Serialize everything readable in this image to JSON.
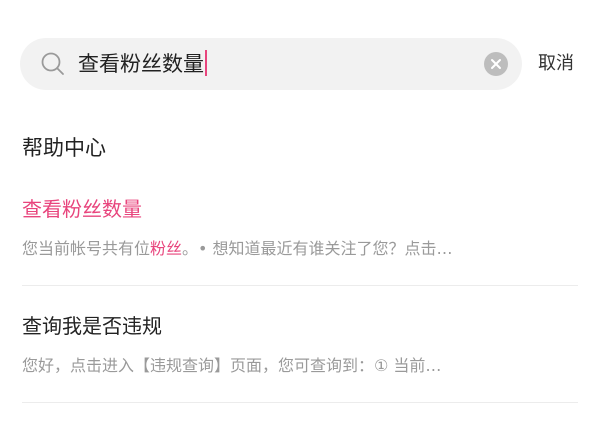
{
  "search": {
    "query": "查看粉丝数量",
    "cancel_label": "取消"
  },
  "section": {
    "title": "帮助中心"
  },
  "results": [
    {
      "title": "查看粉丝数量",
      "snippet_before": "您当前帐号共有位",
      "snippet_highlight": "粉丝",
      "snippet_after": "。• 想知道最近有谁关注了您？点击…"
    },
    {
      "title": "查询我是否违规",
      "snippet": "您好，点击进入【违规查询】页面，您可查询到：① 当前…"
    }
  ],
  "colors": {
    "accent": "#e8457d",
    "search_bg": "#f2f2f2",
    "muted_text": "#9a9a9a"
  }
}
